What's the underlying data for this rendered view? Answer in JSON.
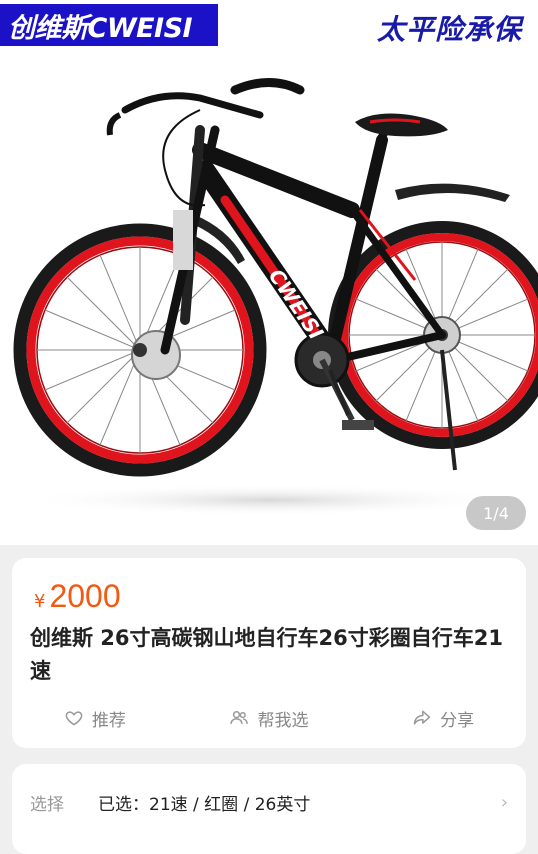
{
  "gallery": {
    "brand_badge": "创维斯CWEISI",
    "insurance_tag": "太平险承保",
    "page_indicator": "1/4",
    "image_alt": "bicycle"
  },
  "product": {
    "currency": "¥",
    "price": "2000",
    "title": "创维斯 26寸高碳钢山地自行车26寸彩圈自行车21速"
  },
  "actions": [
    {
      "label": "推荐",
      "icon": "heart-icon"
    },
    {
      "label": "帮我选",
      "icon": "people-icon"
    },
    {
      "label": "分享",
      "icon": "share-icon"
    }
  ],
  "selection": {
    "label": "选择",
    "value": "已选：21速 / 红圈 / 26英寸"
  },
  "colors": {
    "price": "#f25a12",
    "brand_badge_bg": "#1b12c8",
    "insurance_text": "#1a1aa8",
    "accent_red": "#e0141c"
  }
}
